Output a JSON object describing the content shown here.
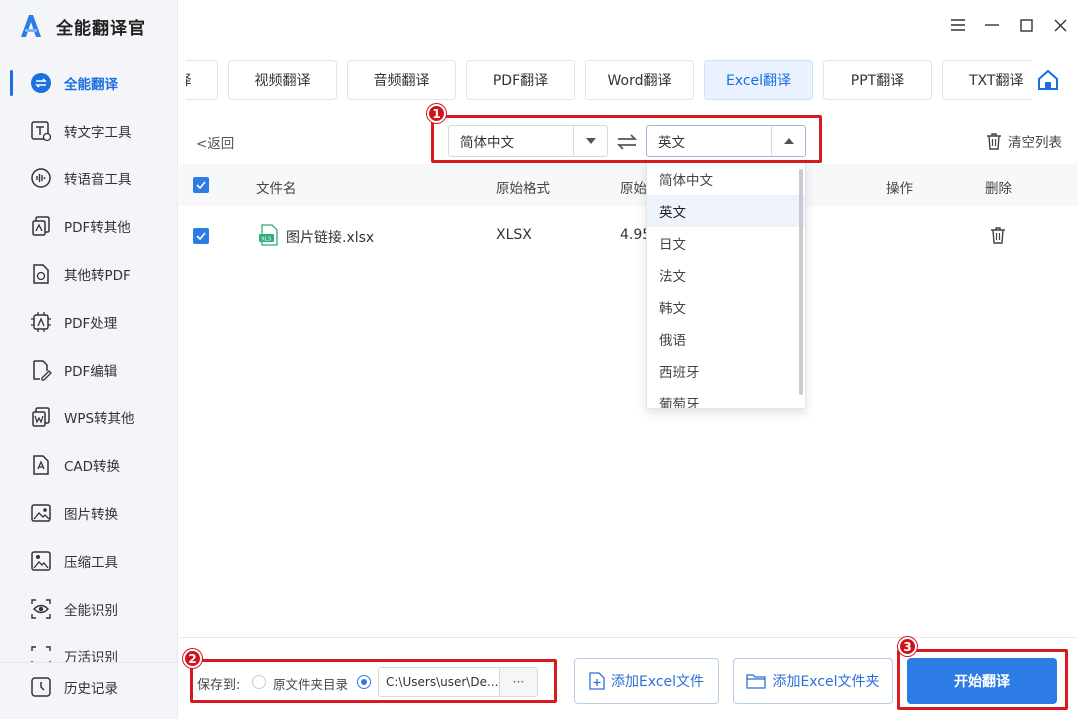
{
  "app": {
    "title": "全能翻译官"
  },
  "colors": {
    "accent": "#1b6fe0",
    "primary_button": "#2d7be5",
    "highlight": "#d71920"
  },
  "sidebar": {
    "items": [
      {
        "label": "全能翻译",
        "icon": "swap-circle-icon",
        "active": true
      },
      {
        "label": "转文字工具",
        "icon": "text-convert-icon"
      },
      {
        "label": "转语音工具",
        "icon": "voice-wave-icon"
      },
      {
        "label": "PDF转其他",
        "icon": "pdf-export-icon"
      },
      {
        "label": "其他转PDF",
        "icon": "pdf-import-icon"
      },
      {
        "label": "PDF处理",
        "icon": "pdf-chip-icon"
      },
      {
        "label": "PDF编辑",
        "icon": "pdf-edit-icon"
      },
      {
        "label": "WPS转其他",
        "icon": "wps-icon"
      },
      {
        "label": "CAD转换",
        "icon": "cad-icon"
      },
      {
        "label": "图片转换",
        "icon": "image-convert-icon"
      },
      {
        "label": "压缩工具",
        "icon": "compress-icon"
      },
      {
        "label": "全能识别",
        "icon": "eye-scan-icon"
      },
      {
        "label": "万活识别",
        "icon": "scan-icon"
      }
    ],
    "history": {
      "label": "历史记录",
      "icon": "history-icon"
    }
  },
  "tabs": [
    {
      "label": "图片翻译"
    },
    {
      "label": "视频翻译"
    },
    {
      "label": "音频翻译"
    },
    {
      "label": "PDF翻译"
    },
    {
      "label": "Word翻译"
    },
    {
      "label": "Excel翻译",
      "active": true
    },
    {
      "label": "PPT翻译"
    },
    {
      "label": "TXT翻译"
    }
  ],
  "toolbar": {
    "back_label": "返回",
    "source_language": "简体中文",
    "target_language": "英文",
    "clear_label": "清空列表"
  },
  "table": {
    "headers": {
      "name": "文件名",
      "format": "原始格式",
      "size": "原始",
      "action": "操作",
      "delete": "删除"
    },
    "rows": [
      {
        "name": "图片链接.xlsx",
        "format": "XLSX",
        "size": "4.95",
        "checked": true
      }
    ]
  },
  "dropdown": {
    "options": [
      "简体中文",
      "英文",
      "日文",
      "法文",
      "韩文",
      "俄语",
      "西班牙",
      "葡萄牙"
    ],
    "selected": "英文"
  },
  "bottom": {
    "save_to_label": "保存到:",
    "radio_original_label": "原文件夹目录",
    "path_value": "C:\\Users\\user\\De...",
    "browse_label": "···",
    "add_file_label": "添加Excel文件",
    "add_folder_label": "添加Excel文件夹",
    "start_label": "开始翻译"
  },
  "annotations": [
    "1",
    "2",
    "3"
  ]
}
